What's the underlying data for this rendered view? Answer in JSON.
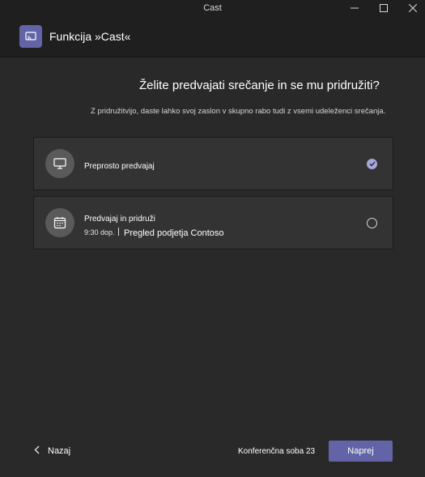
{
  "window": {
    "title": "Cast",
    "minimize_icon": "minimize-icon",
    "maximize_icon": "maximize-icon",
    "close_icon": "close-icon"
  },
  "header": {
    "icon": "cast-icon",
    "title": "Funkcija »Cast«"
  },
  "main": {
    "question": "Želite predvajati srečanje in se mu pridružiti?",
    "subtitle": "Z pridružitvijo, daste lahko svoj zaslon v skupno rabo tudi z vsemi udeleženci srečanja."
  },
  "options": [
    {
      "label": "Preprosto predvajaj",
      "icon": "monitor-icon",
      "selected": true
    },
    {
      "label": "Predvajaj in pridruži",
      "time": "9:30 dop.",
      "meeting": "Pregled podjetja Contoso",
      "icon": "calendar-icon",
      "selected": false
    }
  ],
  "footer": {
    "back_label": "Nazaj",
    "room": "Konferenčna soba 23",
    "next_label": "Naprej"
  },
  "colors": {
    "accent": "#6264a7",
    "check": "#a6a7dc",
    "background": "#292929",
    "card": "#333333"
  }
}
